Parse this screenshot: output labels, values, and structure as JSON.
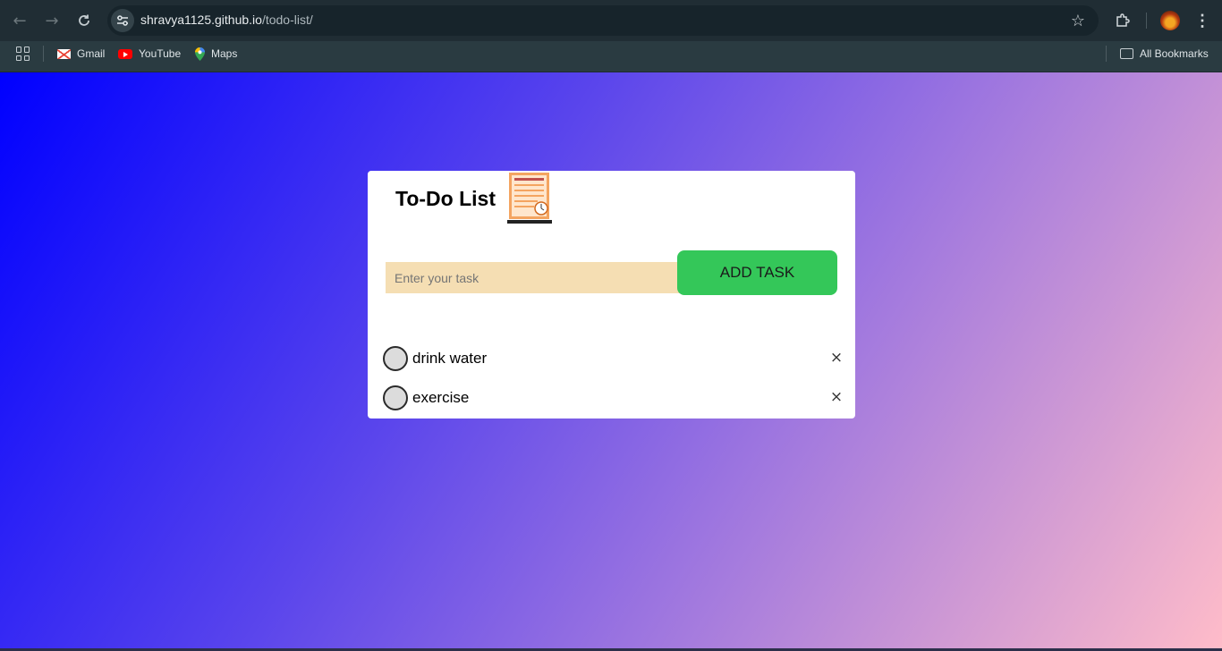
{
  "browser": {
    "url_host": "shravya1125.github.io",
    "url_path": "/todo-list/",
    "bookmarks": [
      {
        "label": "Gmail",
        "icon": "gmail-icon"
      },
      {
        "label": "YouTube",
        "icon": "youtube-icon"
      },
      {
        "label": "Maps",
        "icon": "maps-icon"
      }
    ],
    "all_bookmarks_label": "All Bookmarks"
  },
  "app": {
    "title": "To-Do List",
    "input_placeholder": "Enter your task",
    "input_value": "",
    "add_button_label": "ADD TASK",
    "tasks": [
      {
        "text": "drink water",
        "done": false
      },
      {
        "text": "exercise",
        "done": false
      }
    ],
    "delete_symbol": "×"
  },
  "colors": {
    "input_bg": "#f5deb3",
    "button_bg": "#34c759",
    "gradient_start": "#0000ff",
    "gradient_end": "#ffbcc9"
  }
}
